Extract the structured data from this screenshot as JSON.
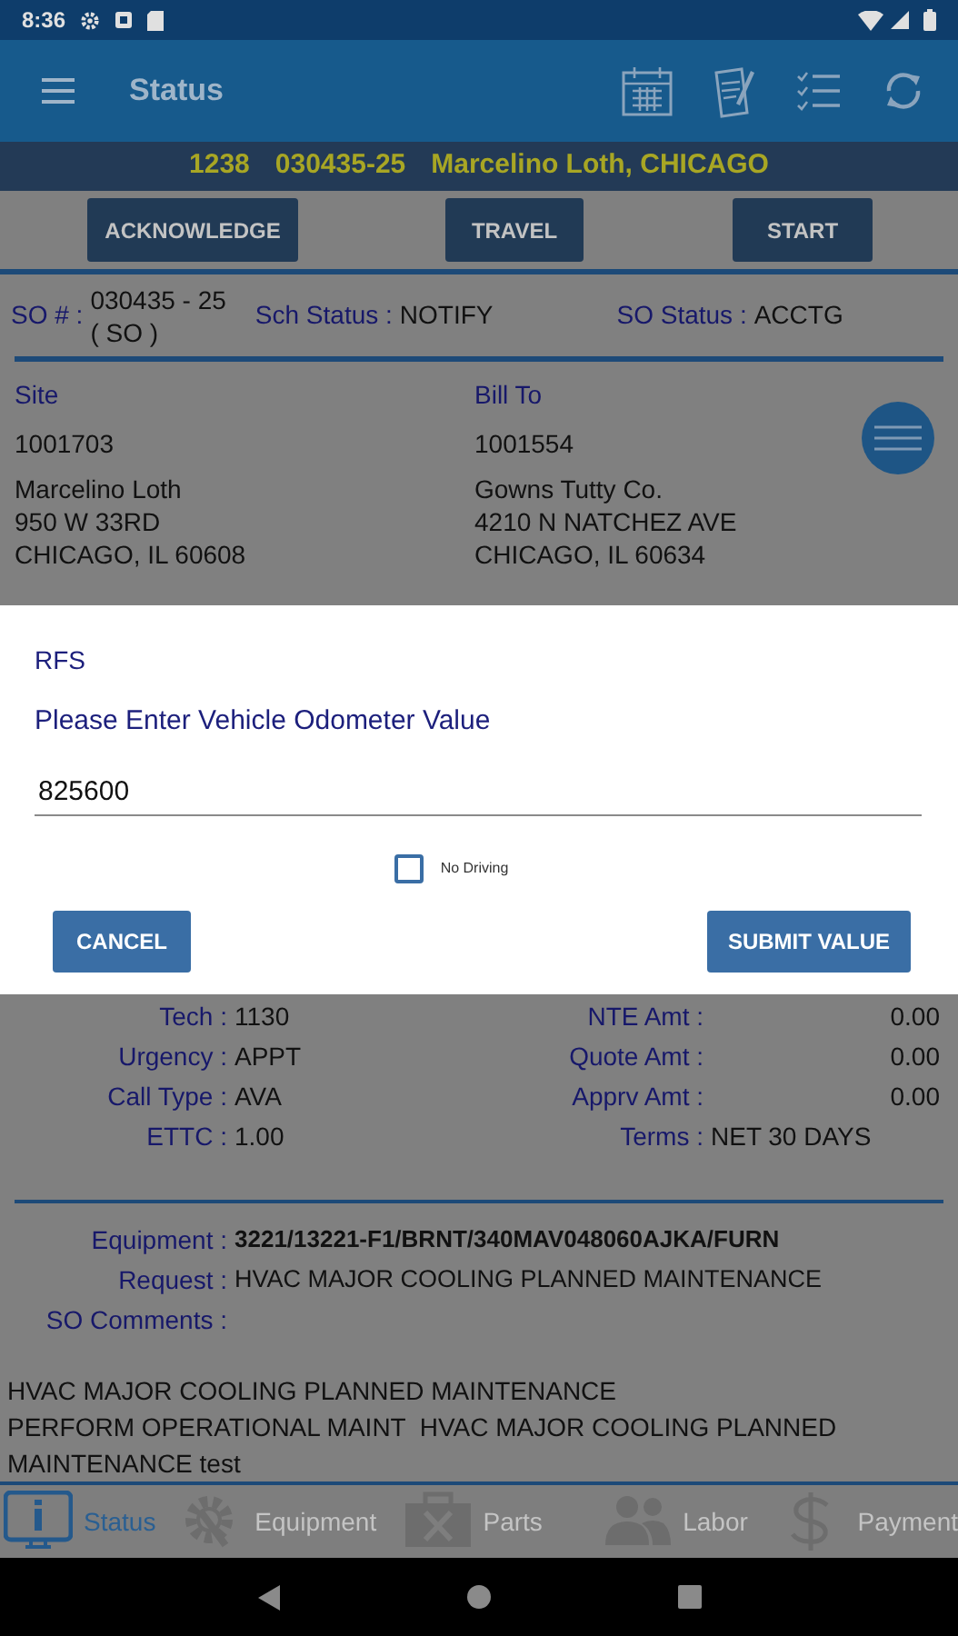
{
  "status_bar": {
    "time": "8:36"
  },
  "app_bar": {
    "title": "Status"
  },
  "header": {
    "items": [
      "1238",
      "030435-25",
      "Marcelino Loth, CHICAGO"
    ]
  },
  "actions": [
    "ACKNOWLEDGE",
    "TRAVEL",
    "START"
  ],
  "so_info": {
    "so_label": "SO # :",
    "so_number": "030435 - 25",
    "so_type": "( SO )",
    "sch_status_label": "Sch Status :",
    "sch_status": "NOTIFY",
    "so_status_label": "SO Status :",
    "so_status": "ACCTG"
  },
  "addresses": [
    {
      "heading": "Site",
      "id": "1001703",
      "lines": [
        "Marcelino Loth",
        "950 W 33RD",
        "CHICAGO, IL  60608"
      ]
    },
    {
      "heading": "Bill To",
      "id": "1001554",
      "lines": [
        "Gowns Tutty Co.",
        "4210 N NATCHEZ AVE",
        "CHICAGO, IL  60634"
      ]
    }
  ],
  "details": [
    {
      "left": {
        "label": "Tech :",
        "value": "1130"
      },
      "right": {
        "label": "NTE Amt :",
        "value": "0.00",
        "kind": "amount"
      }
    },
    {
      "left": {
        "label": "Urgency :",
        "value": "APPT"
      },
      "right": {
        "label": "Quote Amt :",
        "value": "0.00",
        "kind": "amount"
      }
    },
    {
      "left": {
        "label": "Call Type :",
        "value": "AVA"
      },
      "right": {
        "label": "Apprv Amt :",
        "value": "0.00",
        "kind": "amount"
      }
    },
    {
      "left": {
        "label": "ETTC :",
        "value": "1.00"
      },
      "right": {
        "label": "Terms :",
        "value": "NET 30 DAYS",
        "kind": "text"
      }
    }
  ],
  "job": [
    {
      "label": "Equipment :",
      "value": "3221/13221-F1/BRNT/340MAV048060AJKA/FURN",
      "bold": true
    },
    {
      "label": "Request :",
      "value": "HVAC MAJOR COOLING PLANNED MAINTENANCE",
      "bold": false
    },
    {
      "label": "SO Comments :"
    }
  ],
  "comments": [
    "HVAC MAJOR COOLING PLANNED MAINTENANCE",
    "PERFORM OPERATIONAL MAINT  HVAC MAJOR COOLING PLANNED",
    "MAINTENANCE test"
  ],
  "dialog": {
    "title": "RFS",
    "prompt": "Please Enter Vehicle Odometer Value",
    "value": "825600",
    "checkbox": {
      "label": "No Driving",
      "checked": false
    },
    "buttons": [
      "CANCEL",
      "SUBMIT VALUE"
    ]
  },
  "tabs": [
    {
      "label": "Status",
      "kind": "info",
      "selected": true
    },
    {
      "label": "Equipment",
      "kind": "gear",
      "selected": false
    },
    {
      "label": "Parts",
      "kind": "toolbox",
      "selected": false
    },
    {
      "label": "Labor",
      "kind": "people",
      "selected": false
    },
    {
      "label": "Payment",
      "kind": "dollar",
      "selected": false
    }
  ]
}
